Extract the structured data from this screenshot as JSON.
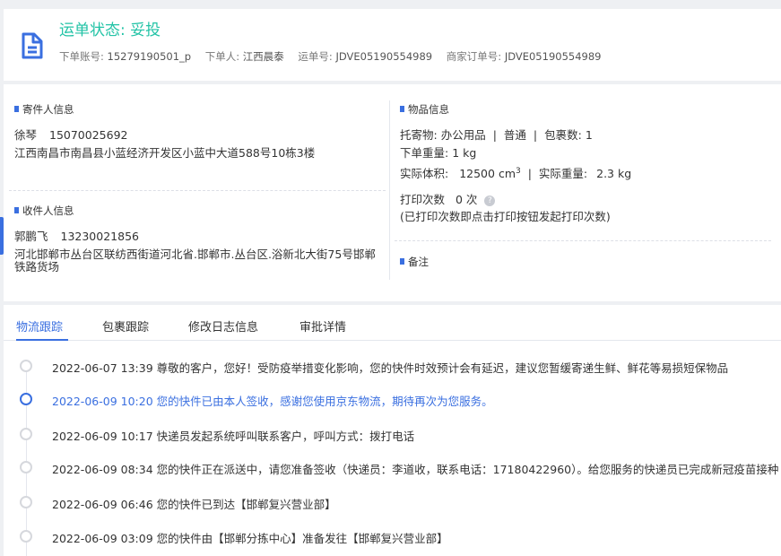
{
  "header": {
    "status_label": "运单状态:",
    "status_value": "妥投",
    "meta": [
      {
        "label": "下单账号:",
        "value": "15279190501_p"
      },
      {
        "label": "下单人:",
        "value": "江西晨泰"
      },
      {
        "label": "运单号:",
        "value": "JDVE05190554989"
      },
      {
        "label": "商家订单号:",
        "value": "JDVE05190554989"
      }
    ]
  },
  "sender": {
    "heading": "寄件人信息",
    "name": "徐琴",
    "phone": "15070025692",
    "address": "江西南昌市南昌县小蓝经济开发区小蓝中大道588号10栋3楼"
  },
  "receiver": {
    "heading": "收件人信息",
    "name": "郭鹏飞",
    "phone": "13230021856",
    "address": "河北邯郸市丛台区联纺西街道河北省.邯郸市.丛台区.浴新北大街75号邯郸铁路货场"
  },
  "goods": {
    "heading": "物品信息",
    "consignment_label": "托寄物:",
    "consignment": "办公用品",
    "service": "普通",
    "package_label": "包裹数:",
    "package_count": "1",
    "weight_label": "下单重量:",
    "weight": "1 kg",
    "volume_label": "实际体积:",
    "volume": "12500 cm",
    "volume_sup": "3",
    "actual_weight_label": "实际重量:",
    "actual_weight": "2.3 kg",
    "print_label": "打印次数",
    "print_count": "0 次",
    "print_note": "(已打印次数即点击打印按钮发起打印次数)"
  },
  "remarks": {
    "heading": "备注"
  },
  "tabs": [
    "物流跟踪",
    "包裹跟踪",
    "修改日志信息",
    "审批详情"
  ],
  "tracking": [
    {
      "time": "2022-06-07 13:39",
      "text": "尊敬的客户，您好！受防疫举措变化影响，您的快件时效预计会有延迟，建议您暂缓寄递生鲜、鲜花等易损短保物品",
      "current": false
    },
    {
      "time": "2022-06-09 10:20",
      "text": "您的快件已由本人签收，感谢您使用京东物流，期待再次为您服务。",
      "current": true
    },
    {
      "time": "2022-06-09 10:17",
      "text": "快递员发起系统呼叫联系客户，呼叫方式：拨打电话",
      "current": false
    },
    {
      "time": "2022-06-09 08:34",
      "text": "您的快件正在派送中，请您准备签收（快递员：李道收，联系电话：17180422960）。给您服务的快递员已完成新冠疫苗接种",
      "current": false
    },
    {
      "time": "2022-06-09 06:46",
      "text": "您的快件已到达【邯郸复兴营业部】",
      "current": false
    },
    {
      "time": "2022-06-09 03:09",
      "text": "您的快件由【邯郸分拣中心】准备发往【邯郸复兴营业部】",
      "current": false
    }
  ],
  "colors": {
    "accent": "#3a6fe0",
    "status": "#22c3a6"
  }
}
